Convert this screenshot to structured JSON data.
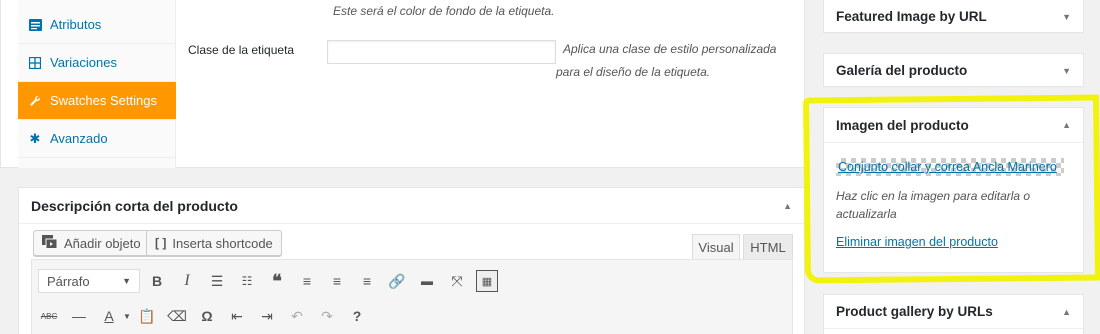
{
  "tabs": [
    {
      "label": "Atributos",
      "icon": "list-icon"
    },
    {
      "label": "Variaciones",
      "icon": "grid-icon"
    },
    {
      "label": "Swatches Settings",
      "icon": "wrench-icon",
      "active": true
    },
    {
      "label": "Avanzado",
      "icon": "gear-icon"
    }
  ],
  "fields": {
    "bg_color_help": "Este será el color de fondo de la etiqueta.",
    "label_class": "Clase de la etiqueta",
    "label_class_value": "",
    "label_class_help_1": "Aplica una clase de estilo personalizada",
    "label_class_help_2": "para el diseño de la etiqueta."
  },
  "short_desc": {
    "title": "Descripción corta del producto",
    "add_media": "Añadir objeto",
    "shortcode": "Inserta shortcode",
    "tab_visual": "Visual",
    "tab_html": "HTML",
    "format_select": "Párrafo"
  },
  "sidebar": {
    "featured_url": "Featured Image by URL",
    "gallery": "Galería del producto",
    "image_title": "Imagen del producto",
    "image_alt": "Conjunto collar y correa Ancla Marinero",
    "image_help_1": "Haz clic en la imagen para editarla o",
    "image_help_2": "actualizarla",
    "remove_image": "Eliminar imagen del producto",
    "gallery_urls": "Product gallery by URLs"
  },
  "colors": {
    "accent": "#ff9800",
    "link": "#0073aa",
    "highlight": "#f2f20f"
  }
}
